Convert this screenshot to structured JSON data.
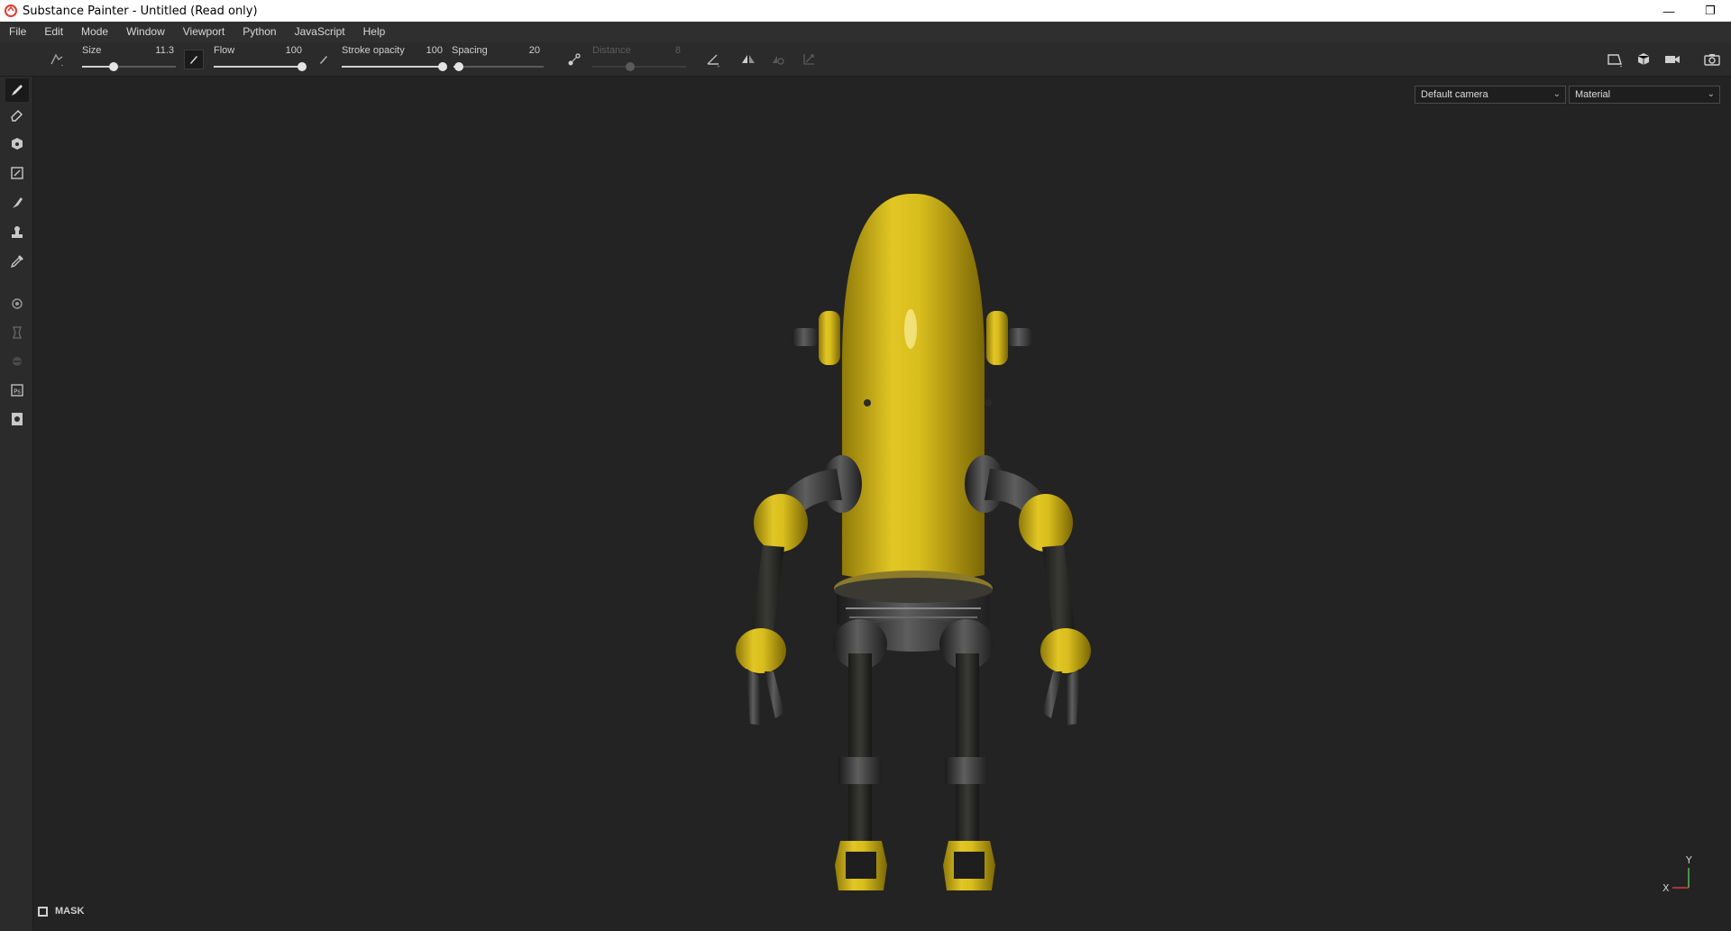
{
  "window": {
    "title": "Substance Painter - Untitled (Read only)",
    "buttons": [
      "—",
      "❐"
    ]
  },
  "menu": [
    "File",
    "Edit",
    "Mode",
    "Window",
    "Viewport",
    "Python",
    "JavaScript",
    "Help"
  ],
  "tool_properties": {
    "size": {
      "label": "Size",
      "value": "11.3",
      "fraction": 0.34
    },
    "flow": {
      "label": "Flow",
      "value": "100",
      "fraction": 1.0
    },
    "stroke_opacity": {
      "label": "Stroke opacity",
      "value": "100",
      "fraction": 1.0
    },
    "spacing": {
      "label": "Spacing",
      "value": "20",
      "fraction": 0.06
    },
    "distance": {
      "label": "Distance",
      "value": "8",
      "fraction": 0.4,
      "disabled": true
    }
  },
  "left_tools": [
    "paint-brush-icon",
    "eraser-icon",
    "projection-icon",
    "polygon-fill-icon",
    "smudge-icon",
    "clone-stamp-icon",
    "color-picker-icon",
    "material-picker-icon",
    "bake-icon",
    "geometry-mask-icon",
    "photoshop-export-icon",
    "texture-export-icon"
  ],
  "right_toolbar_icons": [
    "2d-view-icon",
    "3d-view-icon",
    "camera-icon",
    "screenshot-icon"
  ],
  "viewport": {
    "camera_dropdown": "Default camera",
    "channel_dropdown": "Material",
    "mask_label": "MASK",
    "gizmo": {
      "x": "X",
      "y": "Y"
    }
  },
  "colors": {
    "accent_yellow": "#d9be1c",
    "metal_dark": "#2e2e2e",
    "viewport_bg": "#232323",
    "panel_bg": "#2b2b2b"
  }
}
